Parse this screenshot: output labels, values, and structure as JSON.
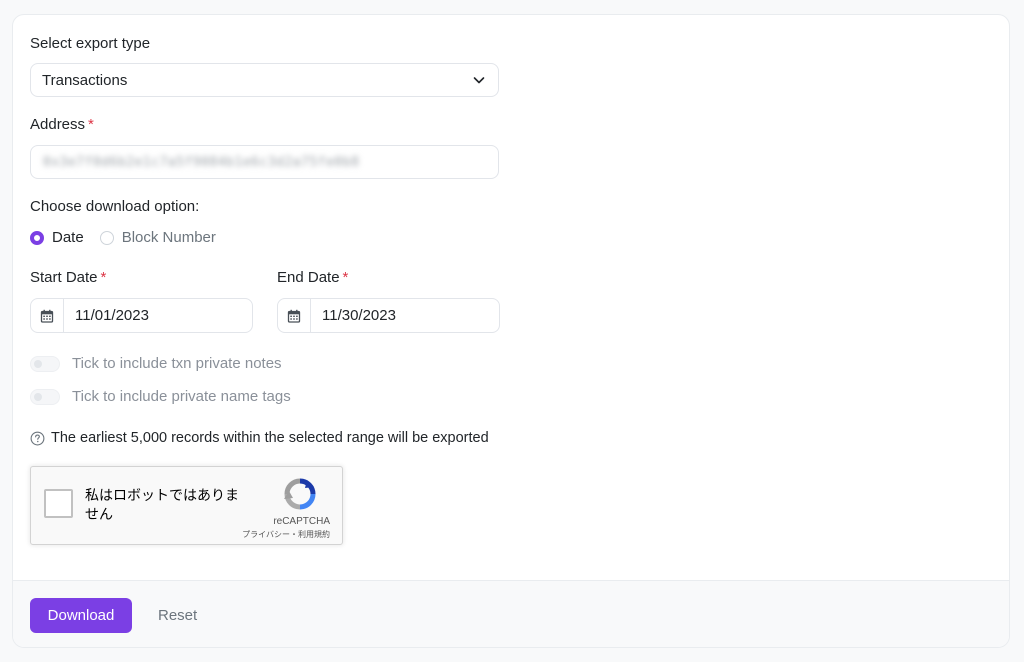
{
  "export_type": {
    "label": "Select export type",
    "selected": "Transactions"
  },
  "address": {
    "label": "Address",
    "required_mark": "*",
    "value": "0x3e7f0d6b2e1c7a5f9084b1e6c3d2a75fe0b8"
  },
  "download_option": {
    "label": "Choose download option:",
    "options": [
      {
        "label": "Date",
        "selected": true
      },
      {
        "label": "Block Number",
        "selected": false
      }
    ]
  },
  "start_date": {
    "label": "Start Date",
    "required_mark": "*",
    "value": "11/01/2023"
  },
  "end_date": {
    "label": "End Date",
    "required_mark": "*",
    "value": "11/30/2023"
  },
  "toggles": [
    {
      "label": "Tick to include txn private notes",
      "on": false
    },
    {
      "label": "Tick to include private name tags",
      "on": false
    }
  ],
  "info": {
    "text": "The earliest 5,000 records within the selected range will be exported"
  },
  "captcha": {
    "text": "私はロボットではありません",
    "brand": "reCAPTCHA",
    "links": "プライバシー・利用規約"
  },
  "footer": {
    "download_label": "Download",
    "reset_label": "Reset"
  },
  "colors": {
    "accent": "#7b3fe4",
    "required": "#dc3545",
    "border": "#e2e5ea"
  }
}
